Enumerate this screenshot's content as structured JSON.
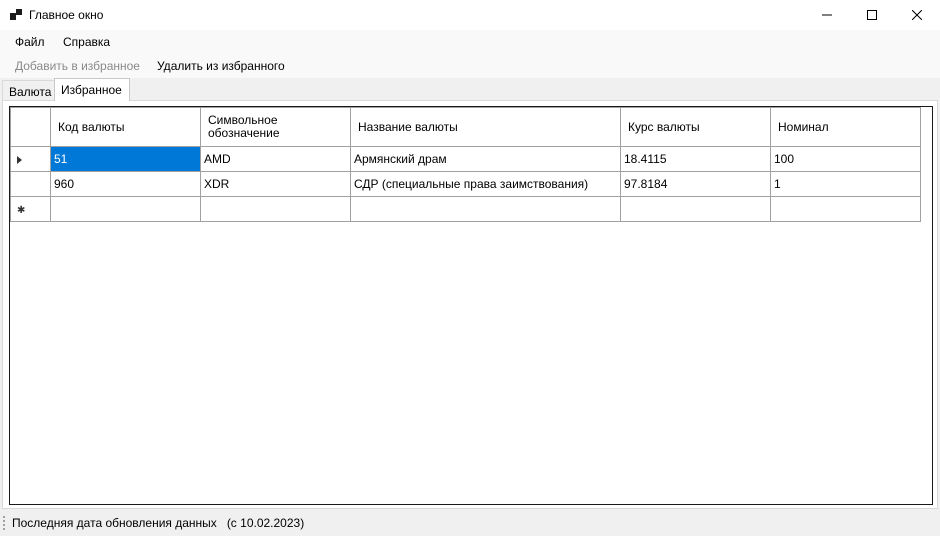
{
  "window": {
    "title": "Главное окно"
  },
  "menu": {
    "items": [
      "Файл",
      "Справка"
    ]
  },
  "toolbar": {
    "add_favorite": "Добавить в избранное",
    "remove_favorite": "Удалить из избранного"
  },
  "tabs": [
    {
      "label": "Валюта",
      "active": false
    },
    {
      "label": "Избранное",
      "active": true
    }
  ],
  "grid": {
    "columns": [
      "Код валюты",
      "Символьное обозначение",
      "Название валюты",
      "Курс валюты",
      "Номинал"
    ],
    "rows": [
      [
        "51",
        "AMD",
        "Армянский драм",
        "18.4115",
        "100"
      ],
      [
        "960",
        "XDR",
        "СДР (специальные права заимствования)",
        "97.8184",
        "1"
      ]
    ],
    "selected_cell_color": "#0078d7"
  },
  "status": {
    "label": "Последняя дата обновления данных",
    "date": "(с 10.02.2023)"
  }
}
